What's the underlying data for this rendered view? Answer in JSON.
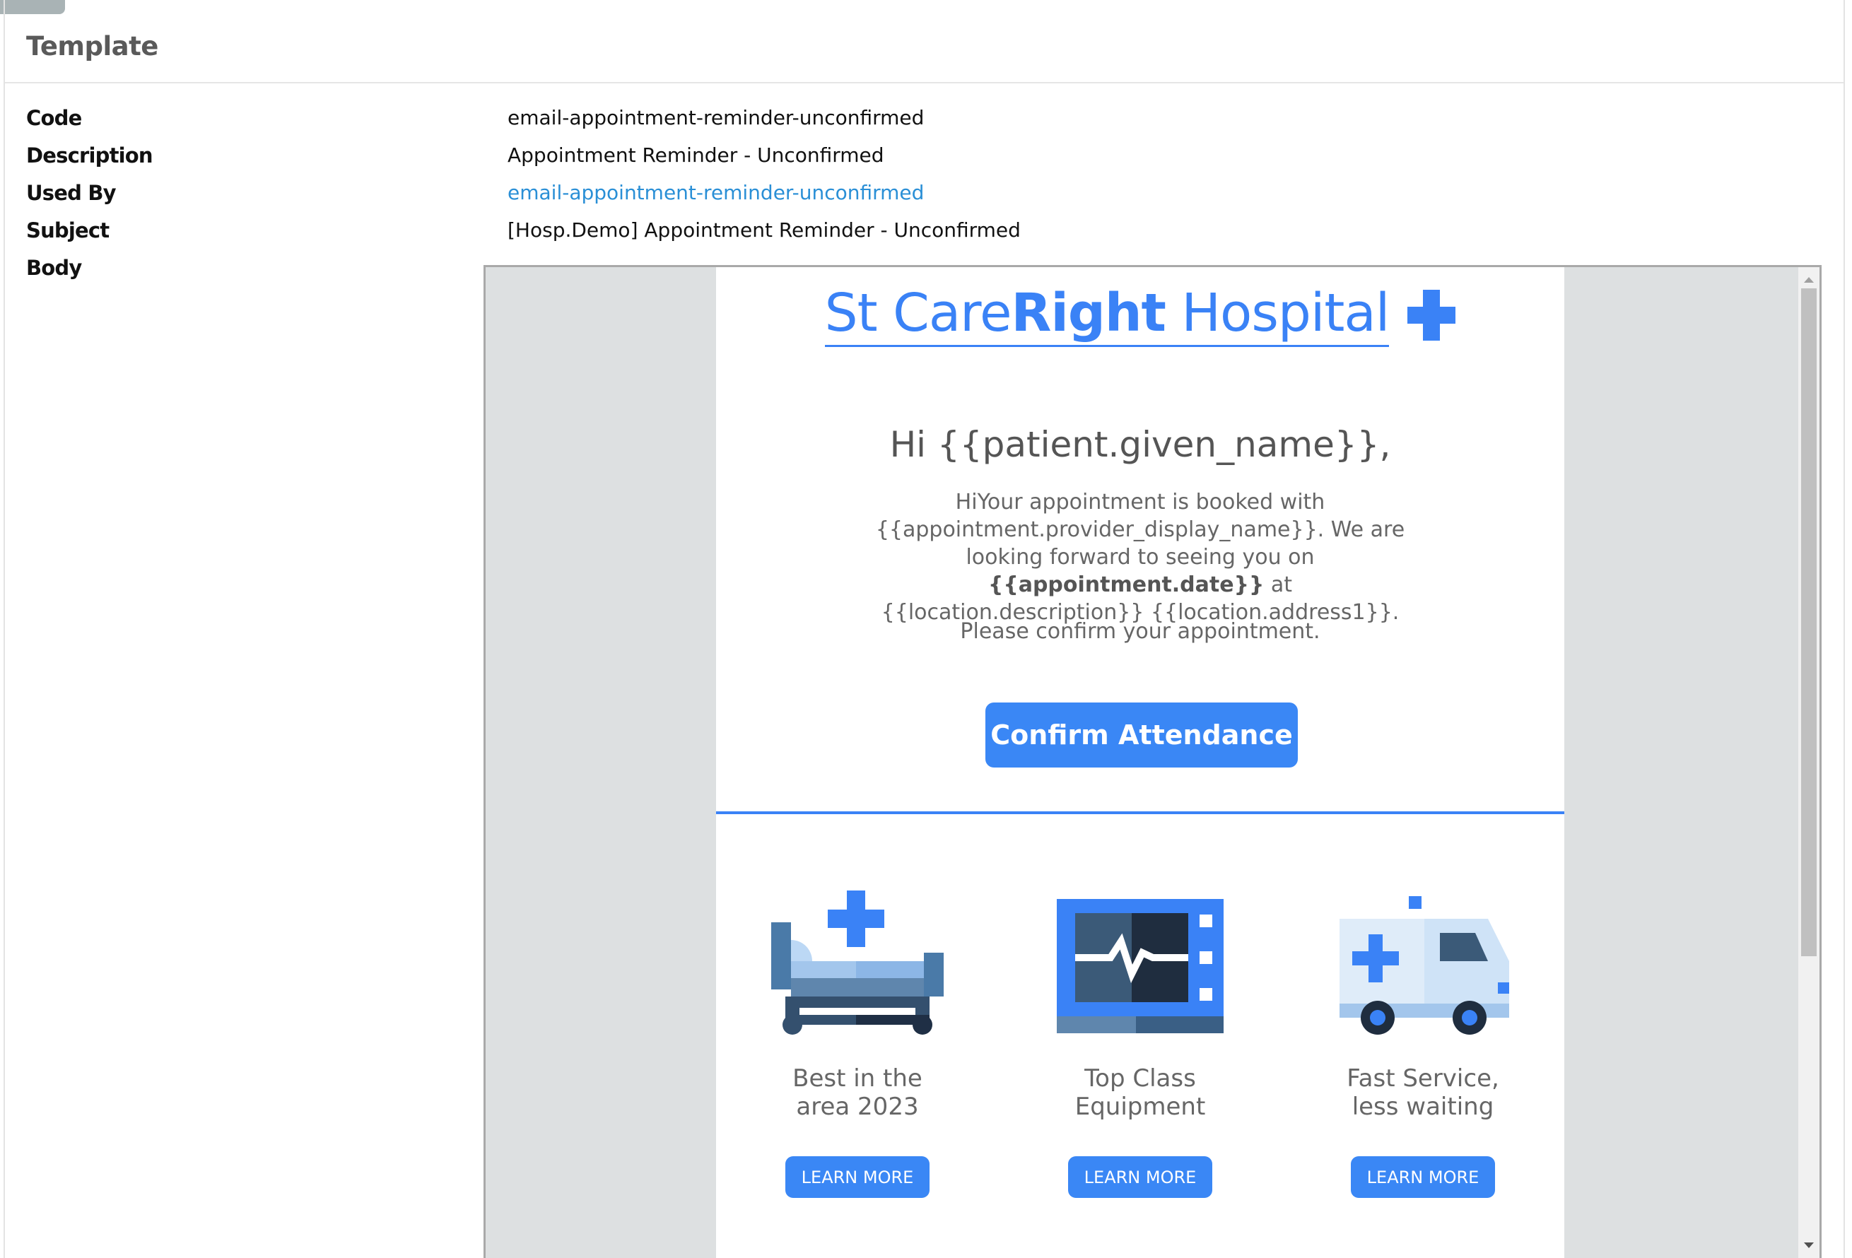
{
  "card": {
    "title": "Template"
  },
  "fields": {
    "code": {
      "label": "Code",
      "value": "email-appointment-reminder-unconfirmed"
    },
    "description": {
      "label": "Description",
      "value": "Appointment Reminder - Unconfirmed"
    },
    "used_by": {
      "label": "Used By",
      "value": "email-appointment-reminder-unconfirmed"
    },
    "subject": {
      "label": "Subject",
      "value": "[Hosp.Demo] Appointment Reminder - Unconfirmed"
    },
    "body": {
      "label": "Body"
    }
  },
  "email": {
    "brand": {
      "part1": "St Care",
      "part2": "Right",
      "part3": " Hospital"
    },
    "greeting": "Hi {{patient.given_name}},",
    "message": {
      "line1": "HiYour appointment is booked with {{appointment.provider_display_name}}. We are looking forward to seeing you on ",
      "date": "{{appointment.date}}",
      "line2": " at {{location.description}} {{location.address1}}."
    },
    "confirm_prompt": "Please confirm your appointment.",
    "confirm_button": "Confirm Attendance",
    "features": [
      {
        "text": "Best in the\narea 2023",
        "button": "LEARN MORE",
        "icon": "hospital-bed-icon"
      },
      {
        "text": "Top Class\nEquipment",
        "button": "LEARN MORE",
        "icon": "heart-monitor-icon"
      },
      {
        "text": "Fast Service,\nless waiting",
        "button": "LEARN MORE",
        "icon": "ambulance-icon"
      }
    ]
  },
  "colors": {
    "accent": "#3a87f5",
    "link": "#2a8fd6"
  }
}
